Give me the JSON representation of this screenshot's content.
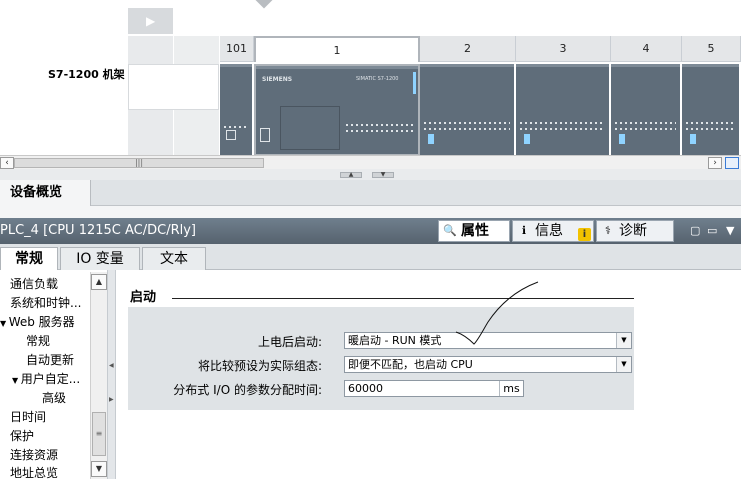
{
  "rack": {
    "row_label": "S7-1200 机架",
    "slots": [
      "101",
      "1",
      "2",
      "3",
      "4",
      "5"
    ],
    "cpu_brand": "SIEMENS",
    "cpu_marking": "SIMATIC S7-1200"
  },
  "bottom_tab": "设备概览",
  "inspector": {
    "title": "PLC_4 [CPU 1215C AC/DC/Rly]",
    "tabs": [
      {
        "label": "属性",
        "icon": "magnifier-icon"
      },
      {
        "label": "信息",
        "icon": "info-icon"
      },
      {
        "label": "诊断",
        "icon": "diagnostics-icon"
      }
    ],
    "info_badge": "i",
    "sub_tabs": [
      "常规",
      "IO 变量",
      "文本"
    ],
    "nav_items": [
      "通信负载",
      "系统和时钟...",
      "Web 服务器",
      "常规",
      "自动更新",
      "用户自定...",
      "高级",
      "日时间",
      "保护",
      "连接资源",
      "地址总览"
    ],
    "section_title": "启动",
    "fields": [
      {
        "label": "上电后启动:",
        "value": "暖启动 - RUN 模式"
      },
      {
        "label": "将比较预设为实际组态:",
        "value": "即便不匹配，也启动 CPU"
      },
      {
        "label": "分布式 I/O 的参数分配时间:",
        "value": "60000",
        "unit": "ms"
      }
    ]
  },
  "colors": {
    "module": "#5f6d7a",
    "title_bar": "#6f7f8d",
    "panel": "#dfe3e6",
    "badge": "#f2c200"
  }
}
